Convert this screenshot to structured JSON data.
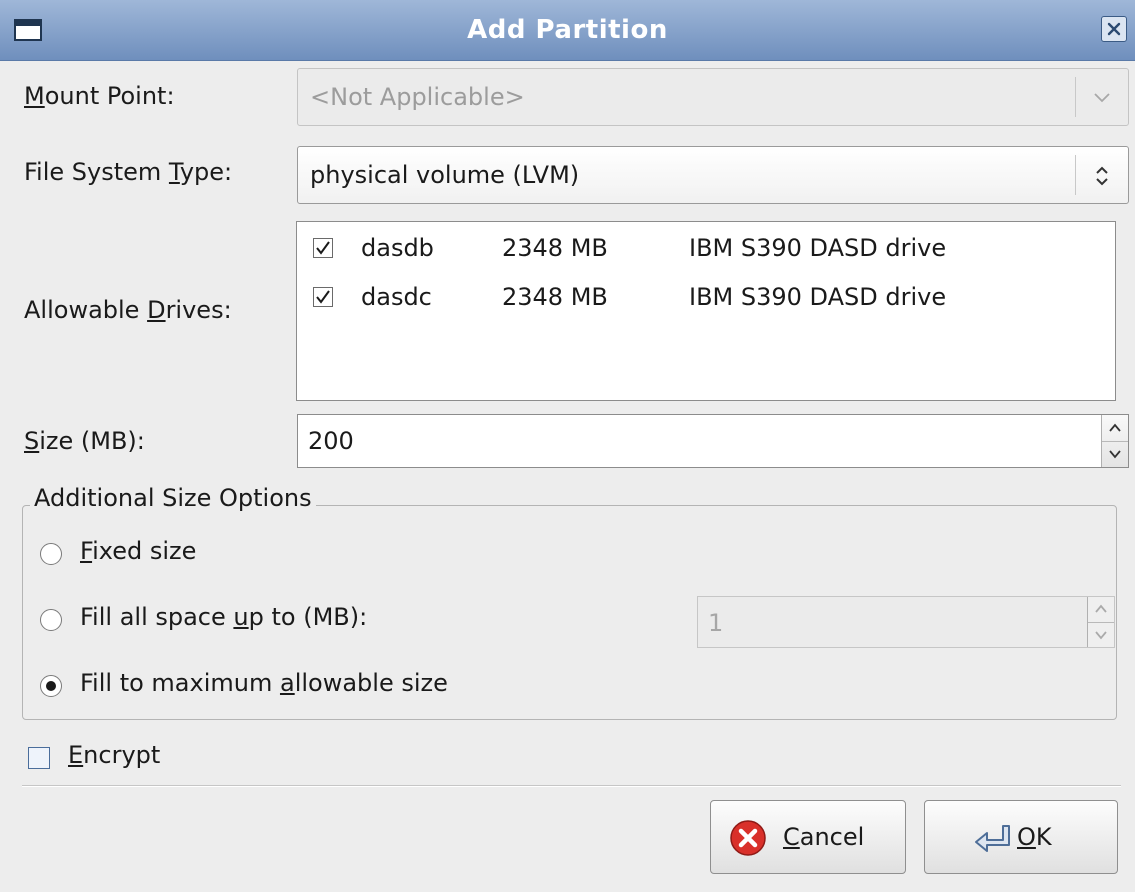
{
  "window": {
    "title": "Add Partition"
  },
  "mount_point": {
    "label_pre": "",
    "label_key": "M",
    "label_post": "ount Point:",
    "value": "<Not Applicable>"
  },
  "fs_type": {
    "label_pre": "File System ",
    "label_key": "T",
    "label_post": "ype:",
    "value": "physical volume (LVM)"
  },
  "drives": {
    "label_pre": "Allowable ",
    "label_key": "D",
    "label_post": "rives:",
    "rows": [
      {
        "name": "dasdb",
        "size": "2348 MB",
        "model": "IBM S390 DASD drive",
        "checked": true
      },
      {
        "name": "dasdc",
        "size": "2348 MB",
        "model": "IBM S390 DASD drive",
        "checked": true
      }
    ]
  },
  "size": {
    "label_pre": "",
    "label_key": "S",
    "label_post": "ize (MB):",
    "value": "200"
  },
  "size_options": {
    "title": "Additional Size Options",
    "fixed": {
      "pre": "",
      "key": "F",
      "post": "ixed size",
      "selected": false
    },
    "fill_up_to": {
      "pre": "Fill all space ",
      "key": "u",
      "post": "p to (MB):",
      "selected": false,
      "value": "1"
    },
    "fill_max": {
      "pre": "Fill to maximum ",
      "key": "a",
      "post": "llowable size",
      "selected": true
    }
  },
  "encrypt": {
    "pre": "",
    "key": "E",
    "post": "ncrypt",
    "checked": false
  },
  "buttons": {
    "cancel": {
      "key": "C",
      "post": "ancel"
    },
    "ok": {
      "key": "O",
      "post": "K"
    }
  }
}
